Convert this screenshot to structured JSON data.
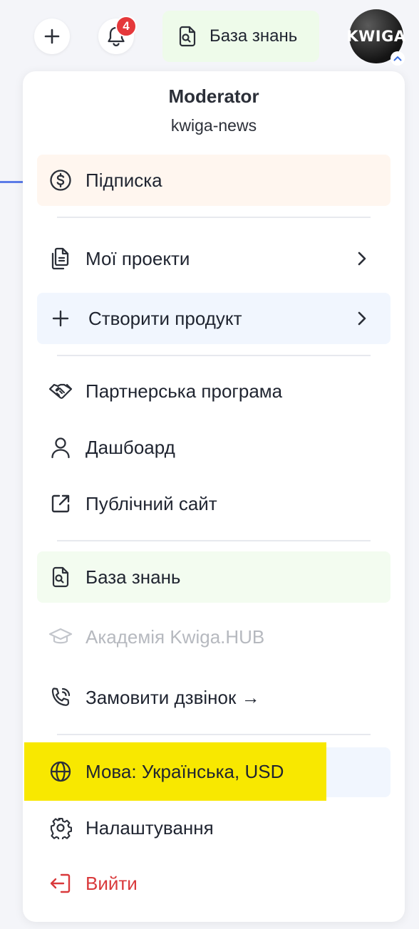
{
  "topbar": {
    "notifications_count": "4",
    "knowledge_base_label": "База знань",
    "avatar_text": "KWIGA"
  },
  "profile": {
    "role": "Moderator",
    "workspace": "kwiga-news"
  },
  "menu": {
    "subscription": "Підписка",
    "my_projects": "Мої проекти",
    "create_product": "Створити продукт",
    "partner_program": "Партнерська програма",
    "dashboard": "Дашбоард",
    "public_site": "Публічний сайт",
    "knowledge_base": "База знань",
    "academy": "Академія Kwiga.HUB",
    "order_call": "Замовити дзвінок →",
    "language": "Мова: Українська, USD",
    "settings": "Налаштування",
    "logout": "Вийти"
  },
  "colors": {
    "highlight": "#f8e800",
    "danger": "#d9393b",
    "badge": "#e5383b"
  }
}
